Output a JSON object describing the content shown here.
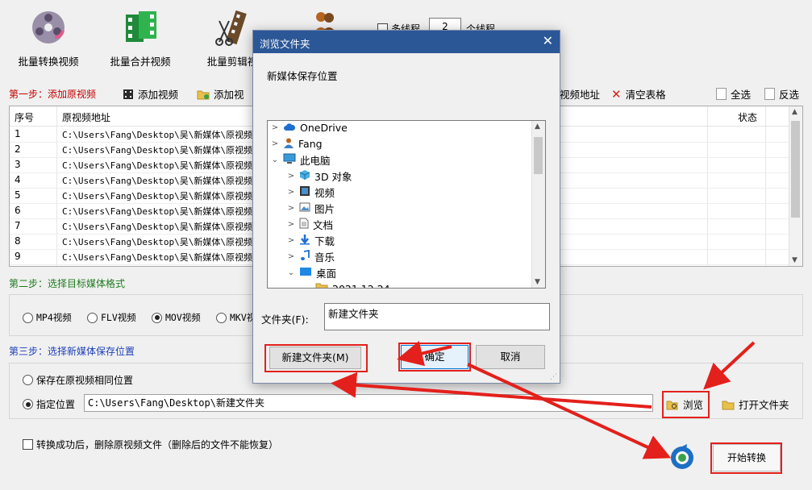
{
  "toolbar": {
    "items": [
      {
        "label": "批量转换视频",
        "icon": "film-reel-icon"
      },
      {
        "label": "批量合并视频",
        "icon": "merge-film-icon"
      },
      {
        "label": "批量剪辑视",
        "icon": "clapper-icon"
      }
    ],
    "multithread_label": "多线程",
    "thread_count": "2",
    "thread_unit": "个线程"
  },
  "step1": {
    "title": "第一步：添加原视频",
    "add_video": "添加视频",
    "add_folder": "添加视",
    "video_address": "视频地址",
    "clear_table": "清空表格",
    "select_all": "全选",
    "invert": "反选"
  },
  "table": {
    "headers": {
      "index": "序号",
      "path": "原视频地址",
      "status": "状态"
    },
    "rows": [
      {
        "index": "1",
        "path": "C:\\Users\\Fang\\Desktop\\吴\\新媒体\\原视频\\"
      },
      {
        "index": "2",
        "path": "C:\\Users\\Fang\\Desktop\\吴\\新媒体\\原视频\\"
      },
      {
        "index": "3",
        "path": "C:\\Users\\Fang\\Desktop\\吴\\新媒体\\原视频\\"
      },
      {
        "index": "4",
        "path": "C:\\Users\\Fang\\Desktop\\吴\\新媒体\\原视频\\"
      },
      {
        "index": "5",
        "path": "C:\\Users\\Fang\\Desktop\\吴\\新媒体\\原视频\\"
      },
      {
        "index": "6",
        "path": "C:\\Users\\Fang\\Desktop\\吴\\新媒体\\原视频\\"
      },
      {
        "index": "7",
        "path": "C:\\Users\\Fang\\Desktop\\吴\\新媒体\\原视频\\"
      },
      {
        "index": "8",
        "path": "C:\\Users\\Fang\\Desktop\\吴\\新媒体\\原视频\\"
      },
      {
        "index": "9",
        "path": "C:\\Users\\Fang\\Desktop\\吴\\新媒体\\原视频\\"
      }
    ]
  },
  "step2": {
    "title": "第二步：选择目标媒体格式",
    "formats": [
      "MP4视频",
      "FLV视频",
      "MOV视频",
      "MKV视"
    ],
    "selected": "MOV视频"
  },
  "step3": {
    "title": "第三步：选择新媒体保存位置",
    "same_location": "保存在原视频相同位置",
    "specify": "指定位置",
    "path_value": "C:\\Users\\Fang\\Desktop\\新建文件夹",
    "browse": "浏览",
    "open_folder": "打开文件夹"
  },
  "footer": {
    "delete_after": "转换成功后，删除原视频文件（删除后的文件不能恢复）",
    "start": "开始转换"
  },
  "dialog": {
    "title": "浏览文件夹",
    "description": "新媒体保存位置",
    "tree": [
      {
        "label": "OneDrive",
        "icon": "cloud-icon",
        "level": 0,
        "expander": "collapsed"
      },
      {
        "label": "Fang",
        "icon": "user-icon",
        "level": 0,
        "expander": "collapsed"
      },
      {
        "label": "此电脑",
        "icon": "computer-icon",
        "level": 0,
        "expander": "expanded"
      },
      {
        "label": "3D 对象",
        "icon": "cube-icon",
        "level": 1,
        "expander": "collapsed"
      },
      {
        "label": "视频",
        "icon": "video-icon",
        "level": 1,
        "expander": "collapsed"
      },
      {
        "label": "图片",
        "icon": "picture-icon",
        "level": 1,
        "expander": "collapsed"
      },
      {
        "label": "文档",
        "icon": "document-icon",
        "level": 1,
        "expander": "collapsed"
      },
      {
        "label": "下载",
        "icon": "download-icon",
        "level": 1,
        "expander": "collapsed"
      },
      {
        "label": "音乐",
        "icon": "music-icon",
        "level": 1,
        "expander": "collapsed"
      },
      {
        "label": "桌面",
        "icon": "desktop-icon",
        "level": 1,
        "expander": "expanded"
      },
      {
        "label": "2021 12 24",
        "icon": "folder-icon",
        "level": 2,
        "expander": "none"
      }
    ],
    "folder_label": "文件夹(F):",
    "folder_value": "新建文件夹",
    "new_folder": "新建文件夹(M)",
    "ok": "确定",
    "cancel": "取消"
  },
  "colors": {
    "annotation_red": "#e3201b",
    "dialog_title": "#2b5797",
    "step1": "#c00000",
    "step2": "#1f7a1f",
    "step3": "#1d3fb5"
  }
}
